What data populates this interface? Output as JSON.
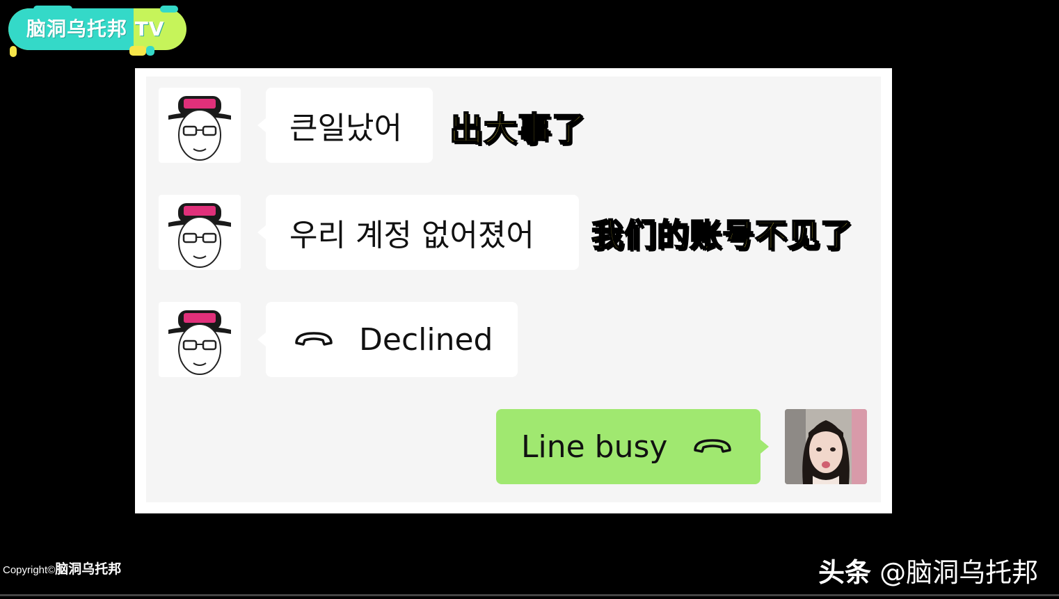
{
  "channel_logo": {
    "text": "脑洞乌托邦 TV"
  },
  "messages": [
    {
      "side": "left",
      "avatar": "cartoon-man-cap-icon",
      "text": "큰일났어",
      "caption": "出大事了"
    },
    {
      "side": "left",
      "avatar": "cartoon-man-cap-icon",
      "text": "우리 계정 없어졌어",
      "caption": "我们的账号不见了"
    },
    {
      "side": "left",
      "avatar": "cartoon-man-cap-icon",
      "icon": "phone-hangup-icon",
      "text": "Declined"
    },
    {
      "side": "right",
      "avatar": "woman-photo-avatar",
      "icon": "phone-hangup-icon",
      "text": "Line busy"
    }
  ],
  "footer": {
    "copyright_prefix": "Copyright©",
    "copyright_brand": "脑洞乌托邦",
    "watermark_prefix": "头条",
    "watermark_handle": "@脑洞乌托邦"
  },
  "colors": {
    "background": "#000000",
    "chat_background": "#f5f5f5",
    "incoming_bubble": "#ffffff",
    "outgoing_bubble": "#a0e870",
    "caption_text": "#ffe94a",
    "logo_green": "#c6f45a",
    "logo_teal": "#34d9c8"
  }
}
